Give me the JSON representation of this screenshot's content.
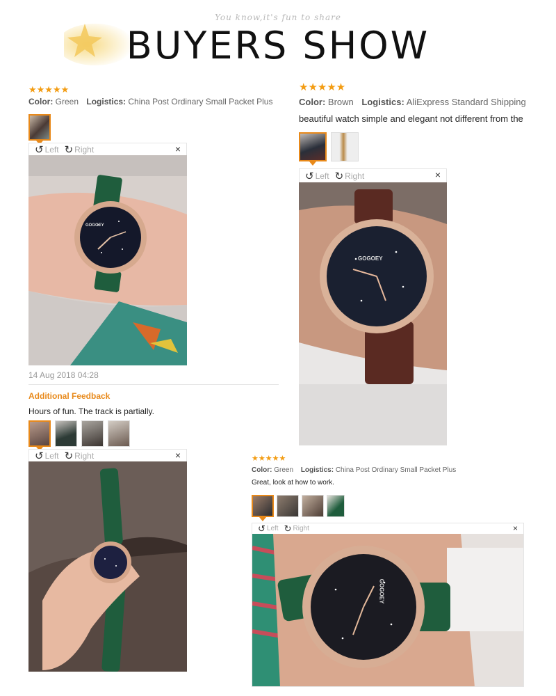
{
  "header": {
    "tagline": "You know,it's fun to share",
    "title": "BUYERS SHOW"
  },
  "colors": {
    "accent": "#e8891a",
    "star": "#f39c12",
    "watch_green": "#1f5d3d",
    "watch_brown": "#5a2a22"
  },
  "review1": {
    "stars": "★★★★★",
    "color_label": "Color:",
    "color_value": "Green",
    "logistics_label": "Logistics:",
    "logistics_value": "China Post Ordinary Small Packet Plus",
    "viewer": {
      "left": "Left",
      "right": "Right",
      "close": "×"
    },
    "date": "14 Aug 2018 04:28",
    "additional_label": "Additional Feedback",
    "additional_text": "Hours of fun. The track is partially.",
    "viewer2": {
      "left": "Left",
      "right": "Right",
      "close": "×"
    }
  },
  "review2": {
    "stars": "★★★★★",
    "color_label": "Color:",
    "color_value": "Brown",
    "logistics_label": "Logistics:",
    "logistics_value": "AliExpress Standard Shipping",
    "comment": "beautiful watch simple and elegant not different from the",
    "viewer": {
      "left": "Left",
      "right": "Right",
      "close": "×"
    }
  },
  "review3": {
    "stars": "★★★★★",
    "color_label": "Color:",
    "color_value": "Green",
    "logistics_label": "Logistics:",
    "logistics_value": "China Post Ordinary Small Packet Plus",
    "comment": "Great, look at how to work.",
    "viewer": {
      "left": "Left",
      "right": "Right",
      "close": "×"
    }
  },
  "brand": "GOGOEY"
}
